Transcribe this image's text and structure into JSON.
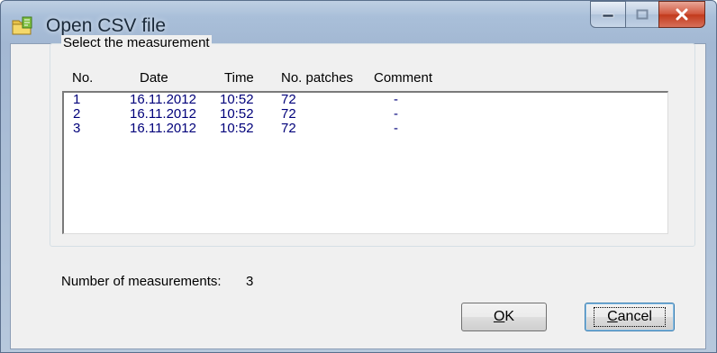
{
  "window": {
    "title": "Open CSV file",
    "icon": "folder-csv-icon",
    "controls": {
      "minimize_icon": "minimize-icon",
      "maximize_icon": "maximize-icon",
      "close_icon": "close-icon"
    }
  },
  "group": {
    "label": "Select the measurement",
    "columns": [
      "No.",
      "Date",
      "Time",
      "No. patches",
      "Comment"
    ],
    "rows": [
      {
        "no": "1",
        "date": "16.11.2012",
        "time": "10:52",
        "patches": "72",
        "comment": "-"
      },
      {
        "no": "2",
        "date": "16.11.2012",
        "time": "10:52",
        "patches": "72",
        "comment": "-"
      },
      {
        "no": "3",
        "date": "16.11.2012",
        "time": "10:52",
        "patches": "72",
        "comment": "-"
      }
    ]
  },
  "status": {
    "label": "Number of measurements:",
    "value": "3"
  },
  "buttons": {
    "ok": {
      "accel": "O",
      "rest": "K"
    },
    "cancel": {
      "accel": "C",
      "rest": "ancel"
    }
  },
  "colors": {
    "list_text": "#00007a",
    "close_button": "#c23a1c",
    "title_bar": "#a9bfd9"
  }
}
